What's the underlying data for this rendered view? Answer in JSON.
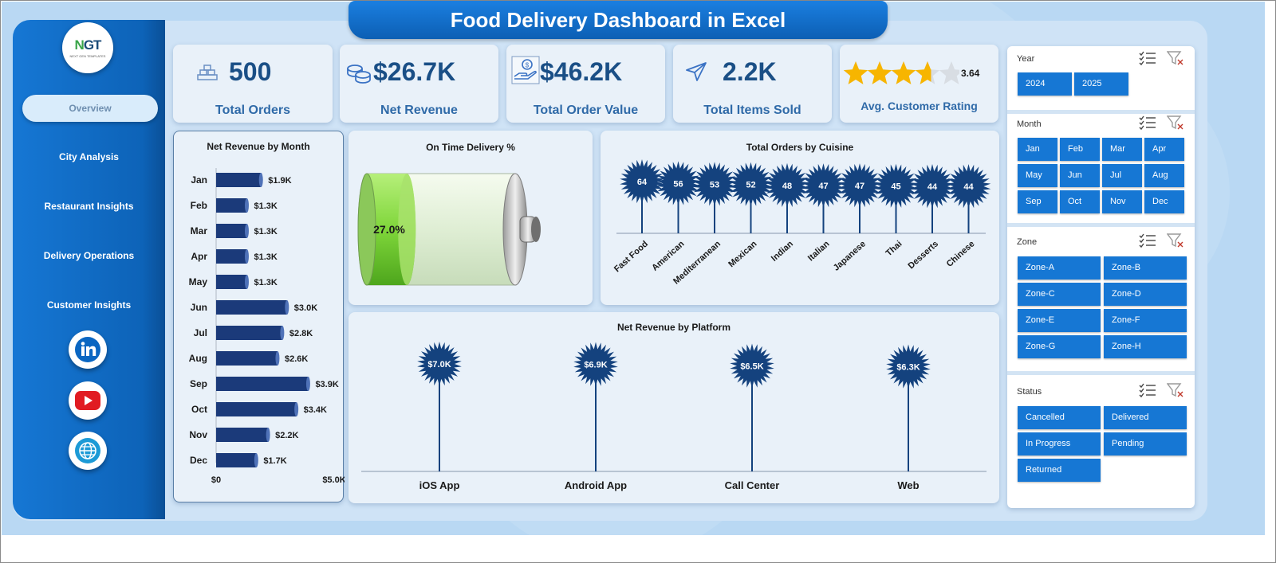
{
  "title": "Food Delivery Dashboard in Excel",
  "logo": {
    "text_main": "NGT",
    "text_sub": "NEXT GEN TEMPLATES"
  },
  "nav": {
    "active": "Overview",
    "items": [
      "Overview",
      "City Analysis",
      "Restaurant Insights",
      "Delivery Operations",
      "Customer Insights"
    ]
  },
  "social_icons": [
    "linkedin-icon",
    "youtube-icon",
    "website-icon"
  ],
  "kpis": {
    "total_orders": {
      "value": "500",
      "label": "Total Orders",
      "icon": "boxes-icon"
    },
    "net_revenue": {
      "value": "$26.7K",
      "label": "Net Revenue",
      "icon": "coins-icon"
    },
    "total_order_value": {
      "value": "$46.2K",
      "label": "Total Order Value",
      "icon": "money-hand-icon"
    },
    "total_items_sold": {
      "value": "2.2K",
      "label": "Total Items Sold",
      "icon": "send-arrow-icon"
    },
    "rating": {
      "value": "3.64",
      "label": "Avg. Customer Rating",
      "stars": 3.64,
      "max_stars": 5,
      "icon": "star-icon"
    }
  },
  "colors": {
    "brand_blue": "#1677d4",
    "bar_navy": "#1b3a7a",
    "burst_navy": "#14427e",
    "star_gold": "#f7b500",
    "battery_green": "#7fd63a"
  },
  "charts": {
    "revenue_by_month": {
      "title": "Net Revenue by Month",
      "labels": [
        "$1.9K",
        "$1.3K",
        "$1.3K",
        "$1.3K",
        "$1.3K",
        "$3.0K",
        "$2.8K",
        "$2.6K",
        "$3.9K",
        "$3.4K",
        "$2.2K",
        "$1.7K"
      ],
      "axis_labels": [
        "$0",
        "$5.0K"
      ]
    },
    "on_time": {
      "title": "On Time Delivery %",
      "label": "27.0%"
    },
    "orders_by_cuisine": {
      "title": "Total Orders by Cuisine"
    },
    "revenue_by_platform": {
      "title": "Net Revenue by Platform",
      "labels": [
        "$7.0K",
        "$6.9K",
        "$6.5K",
        "$6.3K"
      ]
    }
  },
  "chart_data": [
    {
      "type": "bar",
      "orientation": "horizontal",
      "title": "Net Revenue by Month",
      "categories": [
        "Jan",
        "Feb",
        "Mar",
        "Apr",
        "May",
        "Jun",
        "Jul",
        "Aug",
        "Sep",
        "Oct",
        "Nov",
        "Dec"
      ],
      "values": [
        1900,
        1300,
        1300,
        1300,
        1300,
        3000,
        2800,
        2600,
        3900,
        3400,
        2200,
        1700
      ],
      "xlim": [
        0,
        5000
      ],
      "grid": false
    },
    {
      "type": "bar",
      "title": "On Time Delivery %",
      "categories": [
        "On Time"
      ],
      "values": [
        27.0
      ],
      "ylim": [
        0,
        100
      ]
    },
    {
      "type": "scatter",
      "title": "Total Orders by Cuisine",
      "categories": [
        "Fast Food",
        "American",
        "Mediterranean",
        "Mexican",
        "Indian",
        "Italian",
        "Japanese",
        "Thai",
        "Desserts",
        "Chinese"
      ],
      "values": [
        64,
        56,
        53,
        52,
        48,
        47,
        47,
        45,
        44,
        44
      ]
    },
    {
      "type": "scatter",
      "title": "Net Revenue by Platform",
      "categories": [
        "iOS App",
        "Android App",
        "Call Center",
        "Web"
      ],
      "values": [
        7000,
        6900,
        6500,
        6300
      ]
    }
  ],
  "slicers": {
    "year": {
      "title": "Year",
      "options": [
        "2024",
        "2025"
      ]
    },
    "month": {
      "title": "Month",
      "options": [
        "Jan",
        "Feb",
        "Mar",
        "Apr",
        "May",
        "Jun",
        "Jul",
        "Aug",
        "Sep",
        "Oct",
        "Nov",
        "Dec"
      ]
    },
    "zone": {
      "title": "Zone",
      "options": [
        "Zone-A",
        "Zone-B",
        "Zone-C",
        "Zone-D",
        "Zone-E",
        "Zone-F",
        "Zone-G",
        "Zone-H"
      ]
    },
    "status": {
      "title": "Status",
      "options": [
        "Cancelled",
        "Delivered",
        "In Progress",
        "Pending",
        "Returned"
      ]
    }
  }
}
